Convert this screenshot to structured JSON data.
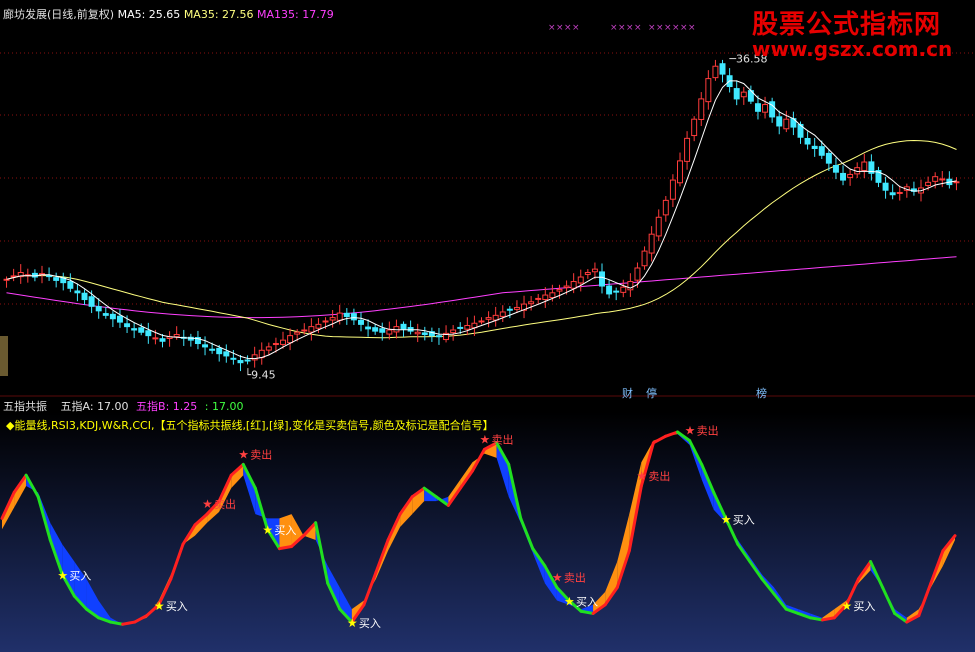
{
  "header": {
    "title": "廊坊发展(日线,前复权)",
    "ma5": "MA5: 25.65",
    "ma35": "MA35: 27.56",
    "ma135": "MA135: 17.79"
  },
  "watermark": {
    "line1": "股票公式指标网",
    "line2": "www.gszx.com.cn"
  },
  "price_labels": {
    "high": "36.58",
    "low": "9.45"
  },
  "tags": {
    "cai": "财",
    "ting": "停",
    "bang": "榜"
  },
  "sub_header": {
    "name": "五指共振",
    "a": "五指A: 17.00",
    "b": "五指B: 1.25",
    "c": ": 17.00"
  },
  "note": "◆能量线,RSI3,KDJ,W&R,CCI,【五个指标共振线,[红],[绿],变化是买卖信号,颜色及标记是配合信号】",
  "signals": {
    "buy": "★买入",
    "sell": "★卖出"
  },
  "colors": {
    "bg": "#000000",
    "up": "#ff3c3c",
    "down": "#40e8ff",
    "ma5": "#ffffff",
    "ma35": "#ffff80",
    "ma135": "#ff40ff",
    "grid": "#8a1010",
    "energy_up": "#ff9010",
    "energy_down": "#1040ff",
    "line_red": "#ff2020",
    "line_green": "#20e020",
    "buy_star": "#ffff00",
    "sell_label": "#ff4040"
  },
  "chart_data": [
    {
      "type": "candlestick",
      "title": "廊坊发展(日线,前复权)",
      "ylim": [
        7,
        40
      ],
      "high_marker": 36.58,
      "low_marker": 9.45,
      "ma5_last": 25.65,
      "ma35_last": 27.56,
      "ma135_last": 17.79,
      "closes": [
        17.0,
        17.3,
        17.6,
        17.4,
        17.2,
        17.5,
        17.3,
        16.9,
        16.7,
        16.2,
        15.8,
        15.2,
        14.6,
        14.2,
        13.8,
        13.5,
        13.2,
        12.8,
        12.5,
        12.3,
        12.0,
        11.8,
        11.5,
        11.9,
        12.1,
        11.8,
        11.6,
        11.3,
        11.0,
        10.7,
        10.4,
        10.2,
        9.9,
        9.6,
        9.8,
        10.3,
        10.7,
        11.0,
        11.3,
        11.6,
        12.0,
        12.3,
        12.5,
        12.8,
        13.0,
        13.3,
        13.6,
        14.0,
        13.7,
        13.4,
        13.0,
        12.6,
        12.4,
        12.3,
        12.5,
        12.8,
        12.6,
        12.4,
        12.3,
        12.1,
        12.0,
        11.9,
        12.2,
        12.5,
        12.7,
        12.9,
        13.1,
        13.3,
        13.6,
        13.8,
        14.1,
        14.3,
        14.5,
        14.8,
        15.0,
        15.3,
        15.6,
        15.8,
        16.1,
        16.4,
        16.8,
        17.2,
        17.6,
        17.9,
        16.4,
        15.7,
        15.9,
        16.3,
        16.8,
        18.0,
        19.5,
        21.0,
        22.5,
        24.0,
        25.8,
        27.5,
        29.5,
        31.2,
        33.0,
        34.8,
        35.9,
        35.2,
        34.1,
        33.0,
        33.6,
        32.8,
        31.9,
        32.5,
        31.4,
        30.6,
        31.2,
        30.5,
        29.6,
        29.0,
        28.6,
        28.0,
        27.3,
        26.5,
        25.8,
        26.3,
        26.9,
        27.4,
        26.4,
        25.6,
        24.9,
        24.5,
        24.7,
        25.2,
        24.8,
        25.1,
        25.6,
        26.1,
        25.9,
        25.4,
        25.65
      ]
    },
    {
      "type": "area",
      "title": "五指共振",
      "series": [
        {
          "name": "五指A",
          "last": 17.0
        },
        {
          "name": "五指B",
          "last": 1.25
        }
      ],
      "ylim": [
        0,
        100
      ],
      "a_values": [
        60,
        72,
        80,
        70,
        50,
        34,
        24,
        18,
        14,
        12,
        11,
        12,
        15,
        20,
        32,
        48,
        57,
        62,
        68,
        80,
        85,
        74,
        55,
        46,
        47,
        52,
        58,
        30,
        18,
        12,
        20,
        35,
        50,
        62,
        70,
        74,
        70,
        66,
        74,
        82,
        92,
        95,
        85,
        60,
        46,
        38,
        28,
        22,
        17,
        16,
        20,
        28,
        45,
        75,
        95,
        98,
        100,
        96,
        85,
        72,
        60,
        48,
        40,
        32,
        25,
        18,
        16,
        14,
        13,
        14,
        20,
        32,
        40,
        28,
        16,
        12,
        15,
        30,
        45,
        52
      ],
      "b_values": [
        55,
        65,
        75,
        72,
        58,
        48,
        40,
        32,
        22,
        14,
        11,
        12,
        14,
        22,
        34,
        48,
        52,
        58,
        63,
        74,
        80,
        62,
        60,
        60,
        62,
        52,
        50,
        38,
        28,
        18,
        22,
        32,
        45,
        56,
        62,
        68,
        68,
        70,
        78,
        86,
        90,
        88,
        70,
        58,
        44,
        30,
        22,
        20,
        18,
        20,
        26,
        40,
        62,
        86,
        96,
        98,
        99,
        94,
        78,
        64,
        58,
        50,
        42,
        34,
        28,
        20,
        18,
        16,
        14,
        18,
        22,
        30,
        36,
        28,
        18,
        14,
        18,
        28,
        38,
        50
      ],
      "buy_signals": [
        {
          "label": "买入",
          "index": 5
        },
        {
          "label": "买入",
          "index": 13
        },
        {
          "label": "买入",
          "index": 22
        },
        {
          "label": "买入",
          "index": 29
        },
        {
          "label": "买入",
          "index": 47
        },
        {
          "label": "买入",
          "index": 60
        },
        {
          "label": "买入",
          "index": 70
        }
      ],
      "sell_signals": [
        {
          "label": "卖出",
          "index": 17
        },
        {
          "label": "卖出",
          "index": 20
        },
        {
          "label": "卖出",
          "index": 40
        },
        {
          "label": "卖出",
          "index": 46
        },
        {
          "label": "卖出",
          "index": 53
        },
        {
          "label": "卖出",
          "index": 57
        }
      ]
    }
  ]
}
